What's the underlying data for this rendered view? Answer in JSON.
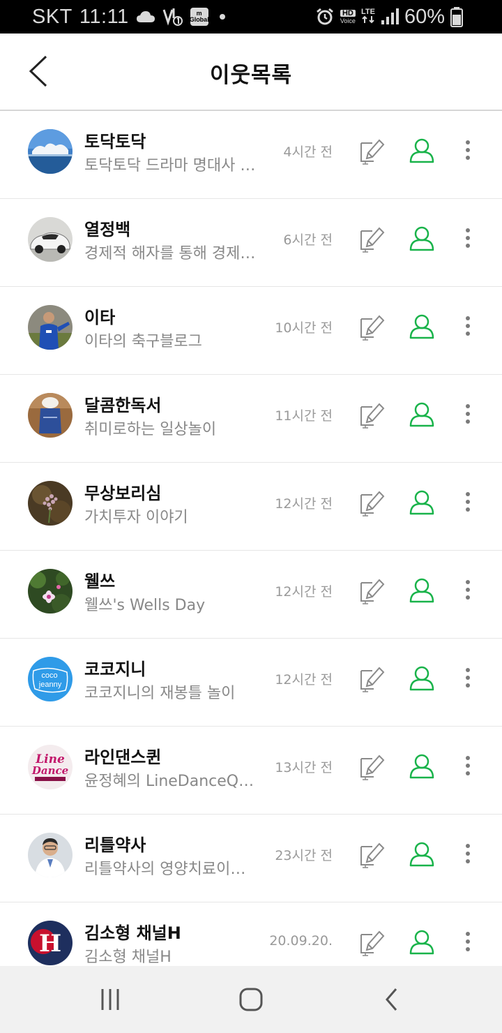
{
  "status_bar": {
    "carrier": "SKT",
    "time": "11:11",
    "hd_badge": "HD",
    "voice_badge": "Voice",
    "lte_badge": "LTE",
    "battery_percent": "60%",
    "global_badge_top": "m",
    "global_badge_bottom": "Global"
  },
  "header": {
    "title": "이웃목록"
  },
  "neighbors": [
    {
      "name": "토닥토닥",
      "desc": "토닥토닥 드라마 명대사 …",
      "time": "4시간 전"
    },
    {
      "name": "열정백",
      "desc": "경제적 해자를 통해 경제…",
      "time": "6시간 전"
    },
    {
      "name": "이타",
      "desc": "이타의 축구블로그",
      "time": "10시간 전"
    },
    {
      "name": "달콤한독서",
      "desc": "취미로하는 일상놀이",
      "time": "11시간 전"
    },
    {
      "name": "무상보리심",
      "desc": "가치투자 이야기",
      "time": "12시간 전"
    },
    {
      "name": "웰쓰",
      "desc": "웰쓰's Wells Day",
      "time": "12시간 전"
    },
    {
      "name": "코코지니",
      "desc": "코코지니의 재봉틀 놀이",
      "time": "12시간 전"
    },
    {
      "name": "라인댄스퀸",
      "desc": "윤정혜의 LineDanceQ…",
      "time": "13시간 전"
    },
    {
      "name": "리틀약사",
      "desc": "리틀약사의 영양치료이…",
      "time": "23시간 전"
    },
    {
      "name": "김소형 채널H",
      "desc": "김소형 채널H",
      "time": "20.09.20."
    }
  ],
  "avatar_text": {
    "coco_line1": "coco",
    "coco_line2": "jeanny",
    "line_top": "Line",
    "line_bottom": "Dance",
    "channel_h": "H"
  },
  "colors": {
    "accent_green": "#19b34a",
    "icon_gray": "#8a8a8a"
  }
}
